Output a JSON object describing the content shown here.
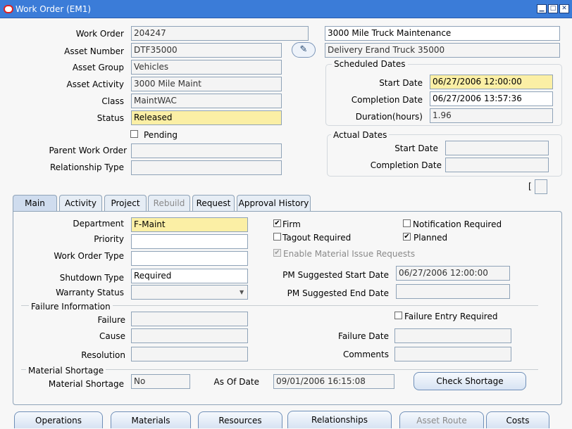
{
  "window": {
    "title": "Work Order (EM1)",
    "controls": {
      "minimize": "▁",
      "maximize": "□",
      "close": "✕"
    }
  },
  "header": {
    "work_order_label": "Work Order",
    "work_order_value": "204247",
    "description_value": "3000 Mile Truck Maintenance",
    "asset_number_label": "Asset Number",
    "asset_number_value": "DTF35000",
    "asset_description_value": "Delivery Erand Truck 35000",
    "asset_group_label": "Asset Group",
    "asset_group_value": "Vehicles",
    "asset_activity_label": "Asset Activity",
    "asset_activity_value": "3000 Mile Maint",
    "class_label": "Class",
    "class_value": "MaintWAC",
    "status_label": "Status",
    "status_value": "Released",
    "pending_label": "Pending",
    "parent_work_order_label": "Parent Work Order",
    "parent_work_order_value": "",
    "relationship_type_label": "Relationship Type",
    "relationship_type_value": ""
  },
  "scheduled_dates": {
    "title": "Scheduled Dates",
    "start_label": "Start Date",
    "start_value": "06/27/2006 12:00:00",
    "completion_label": "Completion Date",
    "completion_value": "06/27/2006 13:57:36",
    "duration_label": "Duration(hours)",
    "duration_value": "1.96"
  },
  "actual_dates": {
    "title": "Actual Dates",
    "start_label": "Start Date",
    "start_value": "",
    "completion_label": "Completion Date",
    "completion_value": ""
  },
  "bracket": "[",
  "tabs": [
    {
      "label": "Main"
    },
    {
      "label": "Activity"
    },
    {
      "label": "Project"
    },
    {
      "label": "Rebuild"
    },
    {
      "label": "Request"
    },
    {
      "label": "Approval History"
    }
  ],
  "main": {
    "department_label": "Department",
    "department_value": "F-Maint",
    "priority_label": "Priority",
    "priority_value": "",
    "work_order_type_label": "Work Order Type",
    "work_order_type_value": "",
    "shutdown_type_label": "Shutdown Type",
    "shutdown_type_value": "Required",
    "warranty_status_label": "Warranty Status",
    "warranty_status_value": "",
    "firm_label": "Firm",
    "firm_checked": "✔",
    "tagout_label": "Tagout Required",
    "notification_label": "Notification Required",
    "planned_label": "Planned",
    "planned_checked": "✔",
    "enable_mir_label": "Enable Material Issue Requests",
    "enable_mir_checked": "✔",
    "pm_start_label": "PM Suggested Start Date",
    "pm_start_value": "06/27/2006 12:00:00",
    "pm_end_label": "PM Suggested End Date",
    "pm_end_value": ""
  },
  "failure": {
    "title": "Failure Information",
    "failure_label": "Failure",
    "failure_value": "",
    "cause_label": "Cause",
    "cause_value": "",
    "resolution_label": "Resolution",
    "resolution_value": "",
    "entry_required_label": "Failure Entry Required",
    "failure_date_label": "Failure Date",
    "failure_date_value": "",
    "comments_label": "Comments",
    "comments_value": ""
  },
  "material_shortage": {
    "title": "Material Shortage",
    "shortage_label": "Material Shortage",
    "shortage_value": "No",
    "as_of_label": "As Of Date",
    "as_of_value": "09/01/2006 16:15:08",
    "check_button": "Check Shortage"
  },
  "bottom_buttons": [
    {
      "label": "Operations"
    },
    {
      "label": "Materials"
    },
    {
      "label": "Resources"
    },
    {
      "label": "Relationships"
    },
    {
      "label": "Asset Route"
    },
    {
      "label": "Costs"
    }
  ],
  "colors": {
    "titlebar": "#3b7cd8",
    "required_field": "#fbefa5",
    "active_tab": "#cfdcee"
  }
}
